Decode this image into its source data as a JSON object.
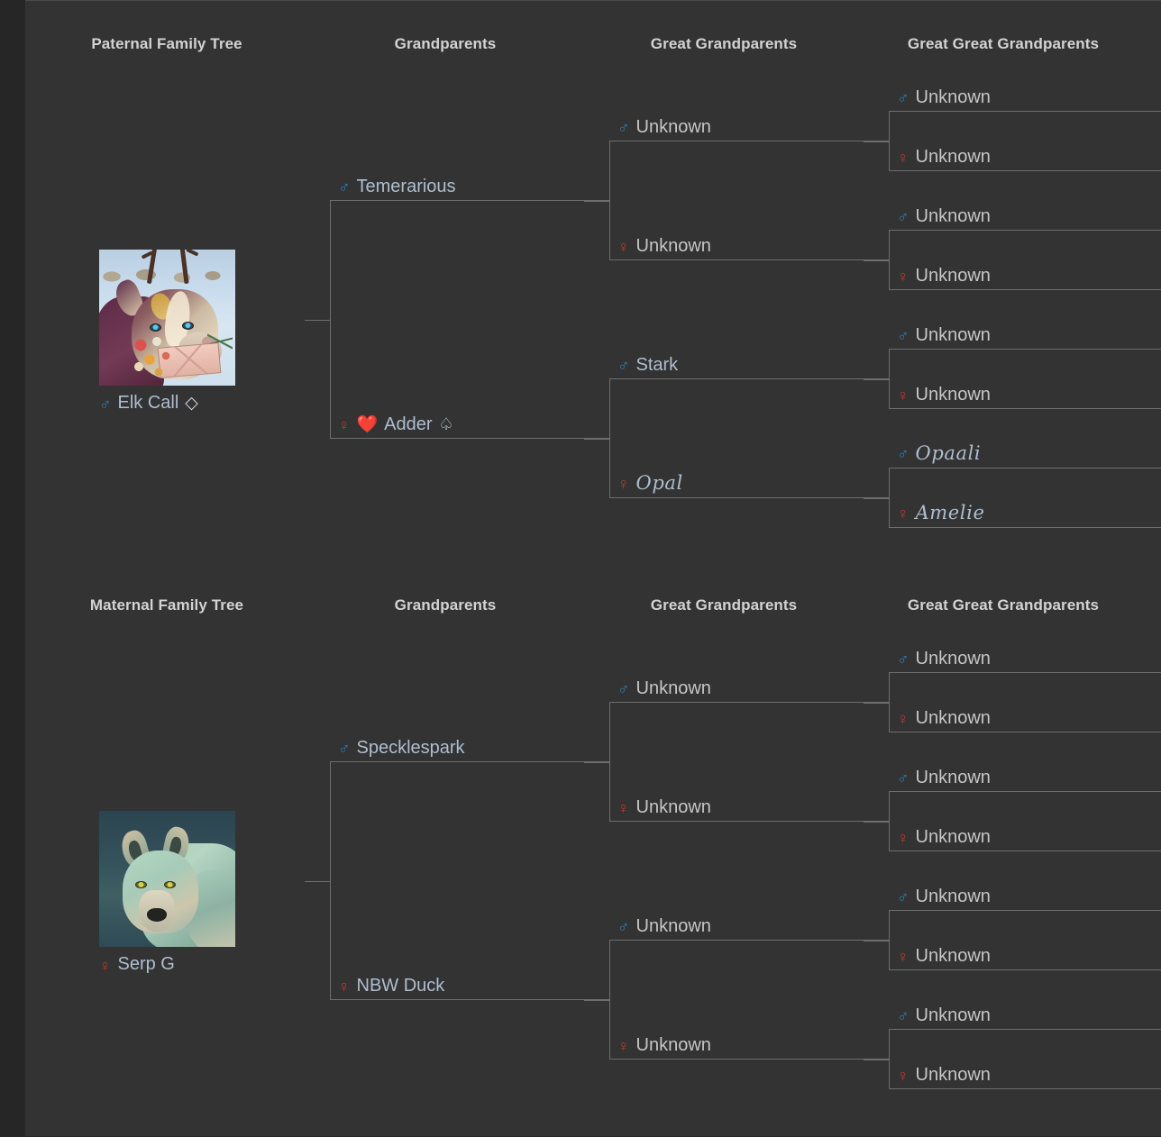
{
  "trees": [
    {
      "id": "paternal",
      "headers": [
        "Paternal Family Tree",
        "Grandparents",
        "Great Grandparents",
        "Great Great Grandparents"
      ],
      "subject": {
        "name": "Elk Call",
        "sex": "male",
        "sex_symbol": "♂",
        "suit": "◇",
        "portrait_alt": "purple and cream wolf with antlers holding a flower-decorated envelope in a snowy caribou herd"
      },
      "grandparents": [
        {
          "sex_symbol": "♂",
          "sex": "male",
          "name": "Temerarious",
          "style": "normal"
        },
        {
          "sex_symbol": "♀",
          "sex": "female",
          "name": "Adder",
          "style": "normal",
          "heart": "❤️",
          "suit": "♤"
        }
      ],
      "great_grandparents": [
        {
          "sex_symbol": "♂",
          "sex": "male",
          "name": "Unknown",
          "style": "unknown"
        },
        {
          "sex_symbol": "♀",
          "sex": "female",
          "name": "Unknown",
          "style": "unknown"
        },
        {
          "sex_symbol": "♂",
          "sex": "male",
          "name": "Stark",
          "style": "normal"
        },
        {
          "sex_symbol": "♀",
          "sex": "female",
          "name": "Opal",
          "style": "script"
        }
      ],
      "great_great_grandparents": [
        {
          "sex_symbol": "♂",
          "sex": "male",
          "name": "Unknown",
          "style": "unknown"
        },
        {
          "sex_symbol": "♀",
          "sex": "female",
          "name": "Unknown",
          "style": "unknown"
        },
        {
          "sex_symbol": "♂",
          "sex": "male",
          "name": "Unknown",
          "style": "unknown"
        },
        {
          "sex_symbol": "♀",
          "sex": "female",
          "name": "Unknown",
          "style": "unknown"
        },
        {
          "sex_symbol": "♂",
          "sex": "male",
          "name": "Unknown",
          "style": "unknown"
        },
        {
          "sex_symbol": "♀",
          "sex": "female",
          "name": "Unknown",
          "style": "unknown"
        },
        {
          "sex_symbol": "♂",
          "sex": "male",
          "name": "Opaali",
          "style": "script"
        },
        {
          "sex_symbol": "♀",
          "sex": "female",
          "name": "Amelie",
          "style": "script"
        }
      ]
    },
    {
      "id": "maternal",
      "headers": [
        "Maternal Family Tree",
        "Grandparents",
        "Great Grandparents",
        "Great Great Grandparents"
      ],
      "subject": {
        "name": "Serp G",
        "sex": "female",
        "sex_symbol": "♀",
        "suit": "",
        "portrait_alt": "teal and green wolf facing forward against a dark blue-green background"
      },
      "grandparents": [
        {
          "sex_symbol": "♂",
          "sex": "male",
          "name": "Specklespark",
          "style": "normal"
        },
        {
          "sex_symbol": "♀",
          "sex": "female",
          "name": "NBW Duck",
          "style": "normal"
        }
      ],
      "great_grandparents": [
        {
          "sex_symbol": "♂",
          "sex": "male",
          "name": "Unknown",
          "style": "unknown"
        },
        {
          "sex_symbol": "♀",
          "sex": "female",
          "name": "Unknown",
          "style": "unknown"
        },
        {
          "sex_symbol": "♂",
          "sex": "male",
          "name": "Unknown",
          "style": "unknown"
        },
        {
          "sex_symbol": "♀",
          "sex": "female",
          "name": "Unknown",
          "style": "unknown"
        }
      ],
      "great_great_grandparents": [
        {
          "sex_symbol": "♂",
          "sex": "male",
          "name": "Unknown",
          "style": "unknown"
        },
        {
          "sex_symbol": "♀",
          "sex": "female",
          "name": "Unknown",
          "style": "unknown"
        },
        {
          "sex_symbol": "♂",
          "sex": "male",
          "name": "Unknown",
          "style": "unknown"
        },
        {
          "sex_symbol": "♀",
          "sex": "female",
          "name": "Unknown",
          "style": "unknown"
        },
        {
          "sex_symbol": "♂",
          "sex": "male",
          "name": "Unknown",
          "style": "unknown"
        },
        {
          "sex_symbol": "♀",
          "sex": "female",
          "name": "Unknown",
          "style": "unknown"
        },
        {
          "sex_symbol": "♂",
          "sex": "male",
          "name": "Unknown",
          "style": "unknown"
        },
        {
          "sex_symbol": "♀",
          "sex": "female",
          "name": "Unknown",
          "style": "unknown"
        }
      ]
    }
  ],
  "colors": {
    "background": "#333333",
    "gutter": "#262626",
    "line": "#6e6e6e",
    "male": "#2f7fb5",
    "female": "#c0392b",
    "name": "#aebed0",
    "unknown": "#c6c6c6",
    "header": "#d3d3d3"
  }
}
